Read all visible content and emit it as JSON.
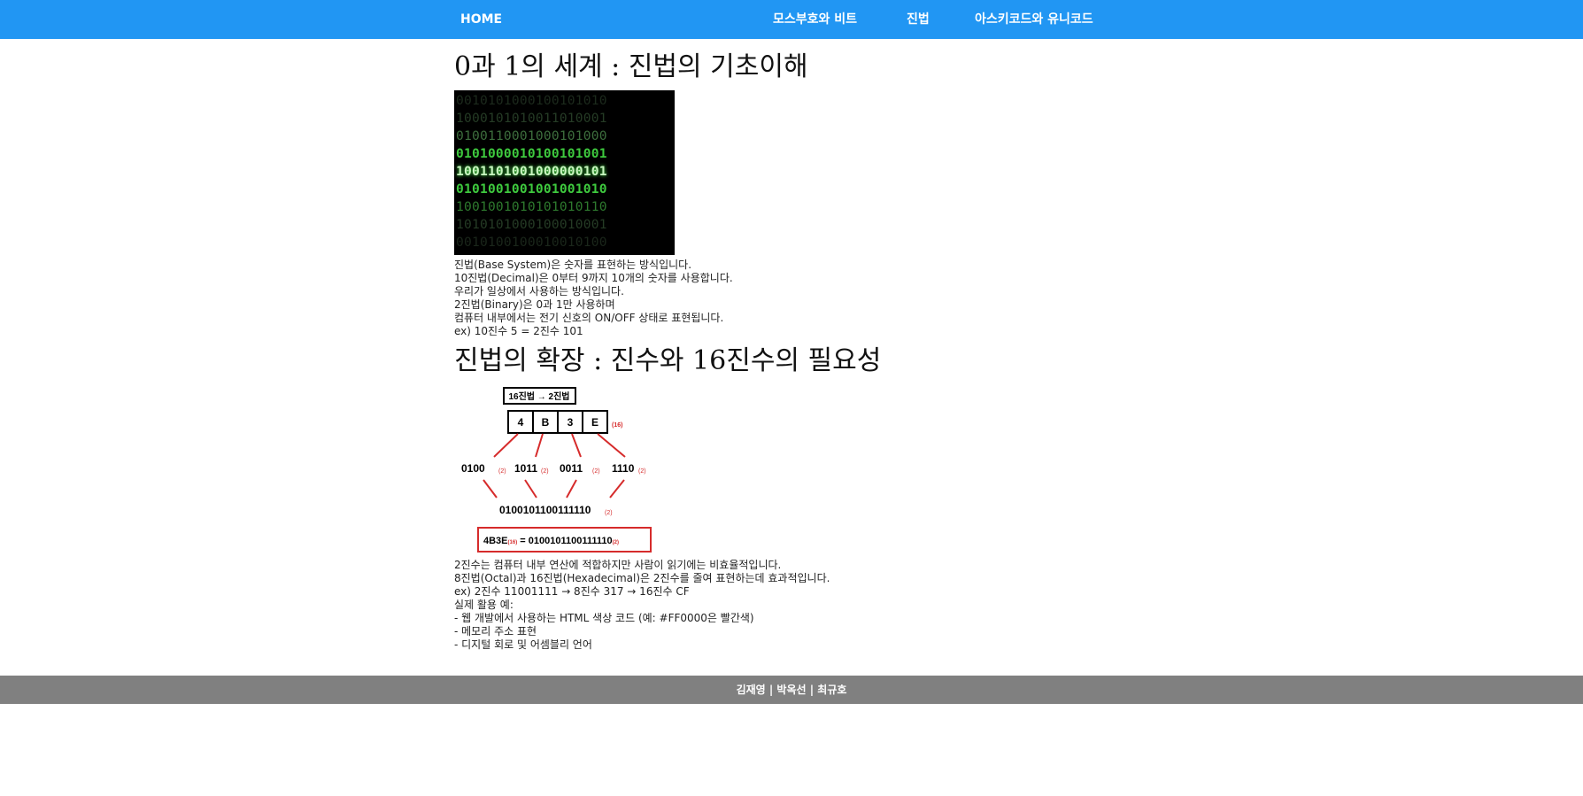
{
  "nav": {
    "home": "HOME",
    "items": [
      "모스부호와 비트",
      "진법",
      "아스키코드와 유니코드"
    ]
  },
  "section1": {
    "title": "0과 1의 세계 : 진법의 기초이해",
    "binary_rows": [
      "0010101000100101010",
      "1000101010011010001",
      "0100110001000101000",
      "0101000010100101001",
      "1001101001000000101",
      "0101001001001001010",
      "1001001010101010110",
      "1010101000100010001",
      "0010100100010010100"
    ],
    "lines": [
      "진법(Base System)은 숫자를 표현하는 방식입니다.",
      "10진법(Decimal)은 0부터 9까지 10개의 숫자를 사용합니다.",
      "우리가 일상에서 사용하는 방식입니다.",
      "2진법(Binary)은 0과 1만 사용하며",
      "컴퓨터 내부에서는 전기 신호의 ON/OFF 상태로 표현됩니다.",
      "ex) 10진수 5 = 2진수 101"
    ]
  },
  "section2": {
    "title": "진법의 확장 : 진수와 16진수의 필요성",
    "diagram": {
      "header": "16진법 → 2진법",
      "hex_digits": [
        "4",
        "B",
        "3",
        "E"
      ],
      "hex_sub": "(16)",
      "groups": [
        "0100",
        "1011",
        "0011",
        "1110"
      ],
      "bin_sub": "(2)",
      "combined": "0100101100111110",
      "result_left": "4B3E",
      "result_eq": " = ",
      "result_right": "0100101100111110"
    },
    "lines": [
      "2진수는 컴퓨터 내부 연산에 적합하지만 사람이 읽기에는 비효율적입니다.",
      "8진법(Octal)과 16진법(Hexadecimal)은 2진수를 줄여 표현하는데 효과적입니다.",
      "ex) 2진수 11001111 → 8진수 317 → 16진수 CF",
      "실제 활용 예:",
      "- 웹 개발에서 사용하는 HTML 색상 코드 (예: #FF0000은 빨간색)",
      "- 메모리 주소 표현",
      "- 디지털 회로 및 어셈블리 언어"
    ]
  },
  "footer": {
    "text": "김재영 | 박옥선 | 최규호"
  },
  "colors": {
    "nav_bg": "#2196f3",
    "footer_bg": "#808080",
    "accent_red": "#d62b2b",
    "matrix_green": "#34c734"
  }
}
